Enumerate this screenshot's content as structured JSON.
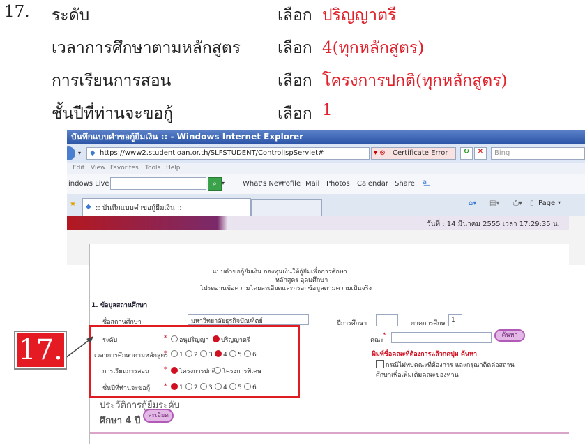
{
  "instructions": {
    "number": "17.",
    "rows": [
      {
        "label": "ระดับ",
        "choose": "เลือก",
        "value": "ปริญญาตรี"
      },
      {
        "label": "เวลาการศึกษาตามหลักสูตร",
        "choose": "เลือก",
        "value": "4(ทุกหลักสูตร)"
      },
      {
        "label": "การเรียนการสอน",
        "choose": "เลือก",
        "value": "โครงการปกติ(ทุกหลักสูตร)"
      },
      {
        "label": "ชั้นปีที่ท่านจะขอกู้",
        "choose": "เลือก",
        "value": "1"
      }
    ]
  },
  "browser": {
    "title": "บันทึกแบบคำขอกู้ยืมเงิน :: - Windows Internet Explorer",
    "url": "https://www2.studentloan.or.th/SLFSTUDENT/ControlJspServlet#",
    "cert_error": "Certificate Error",
    "search_placeholder": "Bing",
    "menu": [
      "Edit",
      "View",
      "Favorites",
      "Tools",
      "Help"
    ],
    "links_label": "indows Live",
    "links": [
      "What's New",
      "Profile",
      "Mail",
      "Photos",
      "Calendar",
      "Share"
    ],
    "tab_title": ":: บันทึกแบบคำขอกู้ยืมเงิน ::",
    "page_menu": "Page",
    "banner_date": "วันที่ : 14 มีนาคม 2555 เวลา 17:29:35 น."
  },
  "form": {
    "heading1": "แบบคำขอกู้ยืมเงิน กองทุนเงินให้กู้ยืมเพื่อการศึกษา",
    "heading2": "หลักสูตร อุดมศึกษา",
    "heading3": "โปรดอ่านข้อความโดยละเอียดและกรอกข้อมูลตามความเป็นจริง",
    "section": "1. ข้อมูลสถานศึกษา",
    "school_label": "ชื่อสถานศึกษา",
    "school_value": "มหาวิทยาลัยธุรกิจบัณฑิตย์",
    "year_label": "ปีการศึกษา",
    "term_label": "ภาคการศึกษา",
    "term_value": "1",
    "level_label": "ระดับ",
    "level_options": [
      "อนุปริญญา",
      "ปริญญาตรี"
    ],
    "faculty_label": "คณะ",
    "search_button": "ค้นหา",
    "faculty_hint": "พิมพ์ชื่อคณะที่ต้องการแล้วกดปุ่ม ค้นหา",
    "duration_label": "เวลาการศึกษาตามหลักสูตร",
    "duration_options": [
      "1",
      "2",
      "3",
      "4",
      "5",
      "6"
    ],
    "teaching_label": "การเรียนการสอน",
    "teaching_options": [
      "โครงการปกติ",
      "โครงการพิเศษ"
    ],
    "not_found_note_1": "กรณีไม่พบคณะที่ต้องการ และกรุณาติดต่อสถาน",
    "not_found_note_2": "ศึกษาเพื่อเพิ่มเติมคณะของท่าน",
    "class_year_label": "ชั้นปีที่ท่านจะขอกู้",
    "class_year_options": [
      "1",
      "2",
      "3",
      "4",
      "5",
      "6"
    ],
    "history_label": "ประวัติการกู้ยืมระดับ",
    "history_value": "ศึกษา 4 ปี",
    "details_button": "ละเอียด",
    "required_mark": "*"
  },
  "callout": {
    "number": "17."
  },
  "colors": {
    "accent_red": "#e0202a",
    "box_red": "#e01b22",
    "pink_button": "#e3b8e6"
  }
}
